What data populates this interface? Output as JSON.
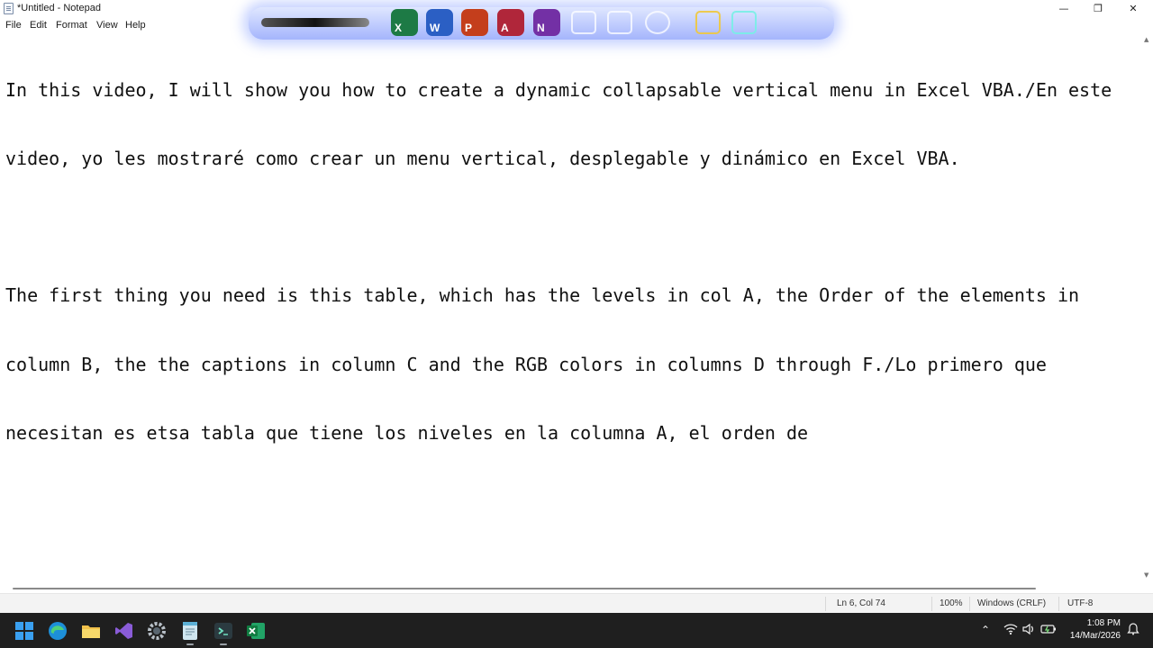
{
  "window": {
    "title": "*Untitled - Notepad",
    "minimize_glyph": "—",
    "maximize_glyph": "❐",
    "close_glyph": "✕"
  },
  "menu": {
    "items": [
      "File",
      "Edit",
      "Format",
      "View",
      "Help"
    ]
  },
  "editor": {
    "lines": [
      "In this video, I will show you how to create a dynamic collapsable vertical menu in Excel VBA./En este",
      "video, yo les mostraré como crear un menu vertical, desplegable y dinámico en Excel VBA.",
      "",
      "The first thing you need is this table, which has the levels in col A, the Order of the elements in",
      "column B, the the captions in column C and the RGB colors in columns D through F./Lo primero que",
      "necesitan es etsa tabla que tiene los niveles en la columna A, el orden de"
    ]
  },
  "status": {
    "position": "Ln 6, Col 74",
    "zoom": "100%",
    "line_ending": "Windows (CRLF)",
    "encoding": "UTF-8"
  },
  "dock": {
    "icons": [
      {
        "name": "excel-icon",
        "letter": "X",
        "color": "#1d7a45"
      },
      {
        "name": "word-icon",
        "letter": "W",
        "color": "#2b5fc4"
      },
      {
        "name": "powerpoint-icon",
        "letter": "P",
        "color": "#c43e1c"
      },
      {
        "name": "access-icon",
        "letter": "A",
        "color": "#b0263a"
      },
      {
        "name": "onenote-icon",
        "letter": "N",
        "color": "#7330a5"
      }
    ]
  },
  "taskbar": {
    "time": "1:08 PM",
    "date": "14/Mar/2026",
    "apps": [
      "windows-start-icon",
      "edge-icon",
      "file-explorer-icon",
      "visual-studio-icon",
      "settings-icon",
      "notepad-icon",
      "terminal-icon",
      "excel-icon"
    ],
    "tray": [
      "chevron-up-icon",
      "wifi-icon",
      "volume-icon",
      "battery-icon",
      "notification-icon"
    ]
  },
  "colors": {
    "taskbar_bg": "#1f1f1f",
    "status_bg": "#f3f3f3",
    "dock_glow": "#6e8cff"
  }
}
